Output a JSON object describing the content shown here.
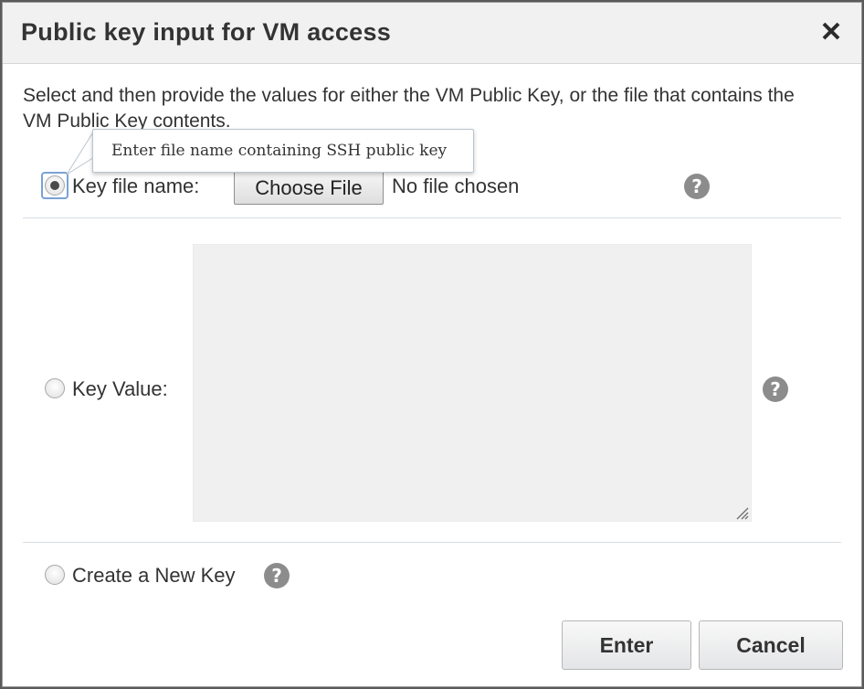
{
  "dialog": {
    "title": "Public key input for VM access",
    "close_icon": "close-icon",
    "description": "Select and then provide the values for either the VM Public Key, or the file that contains the VM Public Key contents."
  },
  "options": {
    "key_file": {
      "label": "Key file name:",
      "selected": true,
      "choose_button": "Choose File",
      "file_status": "No file chosen",
      "help_icon": "question-icon"
    },
    "key_value": {
      "label": "Key Value:",
      "selected": false,
      "value": "",
      "help_icon": "question-icon"
    },
    "new_key": {
      "label": "Create a New Key",
      "selected": false,
      "help_icon": "question-icon"
    }
  },
  "tooltip": {
    "text": "Enter file name containing SSH public key"
  },
  "buttons": {
    "enter": "Enter",
    "cancel": "Cancel"
  },
  "colors": {
    "header_bg": "#f1f1f2",
    "help_icon_bg": "#8c8c8c",
    "textarea_bg": "#f0f0f1",
    "focus_ring": "#7aa1d6"
  }
}
